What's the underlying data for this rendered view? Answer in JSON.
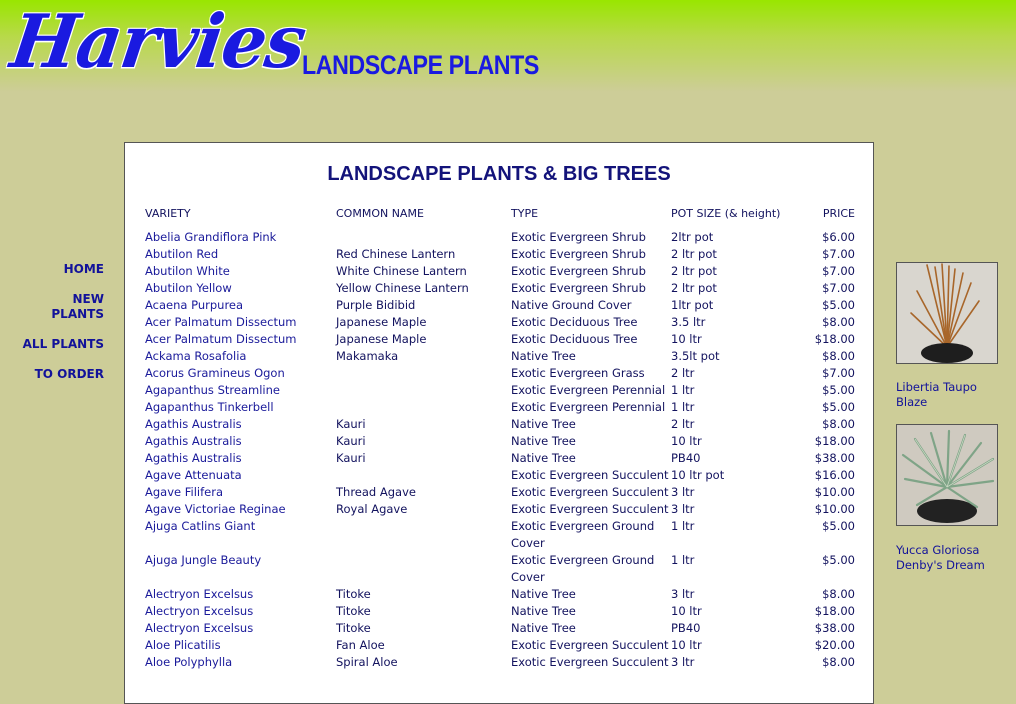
{
  "brand": {
    "logo": "Harvies",
    "subtitle": "LANDSCAPE PLANTS"
  },
  "nav": [
    {
      "label": "HOME"
    },
    {
      "label": "NEW PLANTS"
    },
    {
      "label": "ALL PLANTS"
    },
    {
      "label": "TO ORDER"
    }
  ],
  "page": {
    "title": "LANDSCAPE PLANTS & BIG TREES"
  },
  "table": {
    "headers": [
      "VARIETY",
      "COMMON NAME",
      "TYPE",
      "POT SIZE (& height)",
      "PRICE"
    ],
    "rows": [
      [
        "Abelia Grandiflora Pink",
        "",
        "Exotic Evergreen Shrub",
        "2ltr pot",
        "$6.00"
      ],
      [
        "Abutilon Red",
        "Red Chinese Lantern",
        "Exotic Evergreen Shrub",
        "2 ltr pot",
        "$7.00"
      ],
      [
        "Abutilon White",
        "White Chinese Lantern",
        "Exotic Evergreen Shrub",
        "2 ltr pot",
        "$7.00"
      ],
      [
        "Abutilon Yellow",
        "Yellow Chinese Lantern",
        "Exotic Evergreen Shrub",
        "2 ltr pot",
        "$7.00"
      ],
      [
        "Acaena Purpurea",
        "Purple Bidibid",
        "Native Ground Cover",
        "1ltr pot",
        "$5.00"
      ],
      [
        "Acer Palmatum Dissectum",
        "Japanese Maple",
        "Exotic Deciduous Tree",
        "3.5 ltr",
        "$8.00"
      ],
      [
        "Acer Palmatum Dissectum",
        "Japanese Maple",
        "Exotic Deciduous Tree",
        "10 ltr",
        "$18.00"
      ],
      [
        "Ackama Rosafolia",
        "Makamaka",
        "Native Tree",
        "3.5lt pot",
        "$8.00"
      ],
      [
        "Acorus Gramineus Ogon",
        "",
        "Exotic Evergreen Grass",
        "2 ltr",
        "$7.00"
      ],
      [
        "Agapanthus Streamline",
        "",
        "Exotic Evergreen Perennial",
        "1 ltr",
        "$5.00"
      ],
      [
        "Agapanthus Tinkerbell",
        "",
        "Exotic Evergreen Perennial",
        "1 ltr",
        "$5.00"
      ],
      [
        "Agathis Australis",
        "Kauri",
        "Native Tree",
        "2 ltr",
        "$8.00"
      ],
      [
        "Agathis Australis",
        "Kauri",
        "Native Tree",
        "10 ltr",
        "$18.00"
      ],
      [
        "Agathis Australis",
        "Kauri",
        "Native Tree",
        "PB40",
        "$38.00"
      ],
      [
        "Agave Attenuata",
        "",
        "Exotic Evergreen Succulent",
        "10 ltr pot",
        "$16.00"
      ],
      [
        "Agave Filifera",
        "Thread Agave",
        "Exotic Evergreen Succulent",
        "3 ltr",
        "$10.00"
      ],
      [
        "Agave Victoriae Reginae",
        "Royal Agave",
        "Exotic Evergreen Succulent",
        "3 ltr",
        "$10.00"
      ],
      [
        "Ajuga Catlins Giant",
        "",
        "Exotic Evergreen Ground Cover",
        "1 ltr",
        "$5.00"
      ],
      [
        "Ajuga Jungle Beauty",
        "",
        "Exotic Evergreen Ground Cover",
        "1 ltr",
        "$5.00"
      ],
      [
        "Alectryon Excelsus",
        "Titoke",
        "Native Tree",
        "3 ltr",
        "$8.00"
      ],
      [
        "Alectryon Excelsus",
        "Titoke",
        "Native Tree",
        "10 ltr",
        "$18.00"
      ],
      [
        "Alectryon Excelsus",
        "Titoke",
        "Native Tree",
        "PB40",
        "$38.00"
      ],
      [
        "Aloe Plicatilis",
        "Fan Aloe",
        "Exotic Evergreen Succulent",
        "10 ltr",
        "$20.00"
      ],
      [
        "Aloe Polyphylla",
        "Spiral Aloe",
        "Exotic Evergreen Succulent",
        "3 ltr",
        "$8.00"
      ]
    ]
  },
  "featured": [
    {
      "caption": "Libertia Taupo Blaze"
    },
    {
      "caption": "Yucca Gloriosa Denby's Dream"
    }
  ]
}
